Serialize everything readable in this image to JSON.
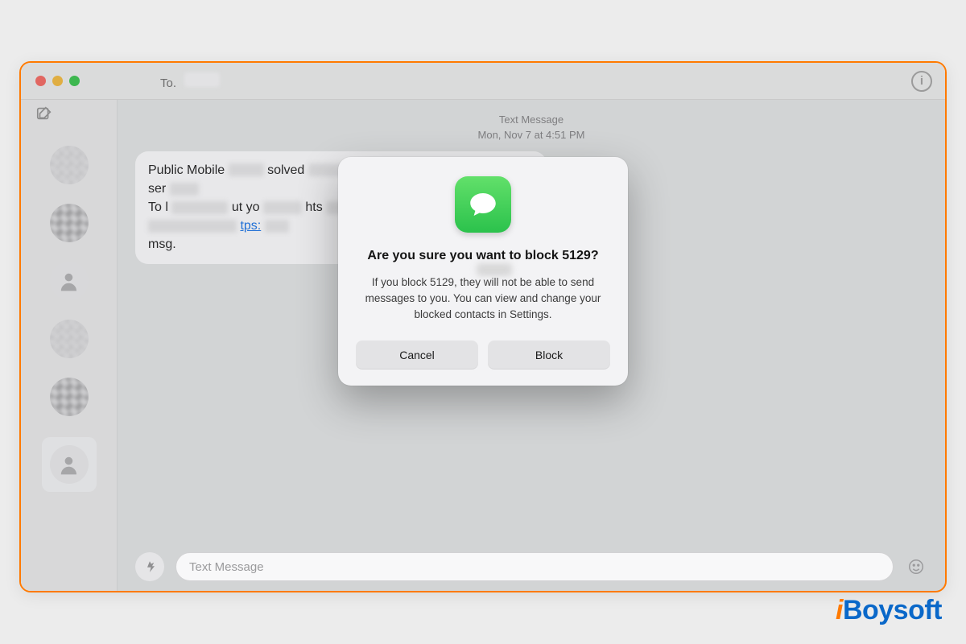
{
  "window": {
    "to_label": "To.",
    "details_glyph": "i"
  },
  "meta": {
    "type_label": "Text Message",
    "timestamp": "Mon, Nov 7 at 4:51 PM"
  },
  "bubble": {
    "line1_prefix": "Public Mobile ",
    "line1_mid": "solved ",
    "line2_prefix": "ser",
    "line3_prefix": "To l",
    "line3_mid": "ut yo",
    "line3_mid2": "hts",
    "line4_link": "tps:",
    "line5": "msg."
  },
  "compose": {
    "placeholder": "Text Message"
  },
  "dialog": {
    "title": "Are you sure you want to block 5129?",
    "body": "If you block 5129, they will not be able to send messages to you. You can view and change your blocked contacts in Settings.",
    "cancel": "Cancel",
    "confirm": "Block"
  },
  "watermark": {
    "i": "i",
    "rest": "Boysoft"
  }
}
